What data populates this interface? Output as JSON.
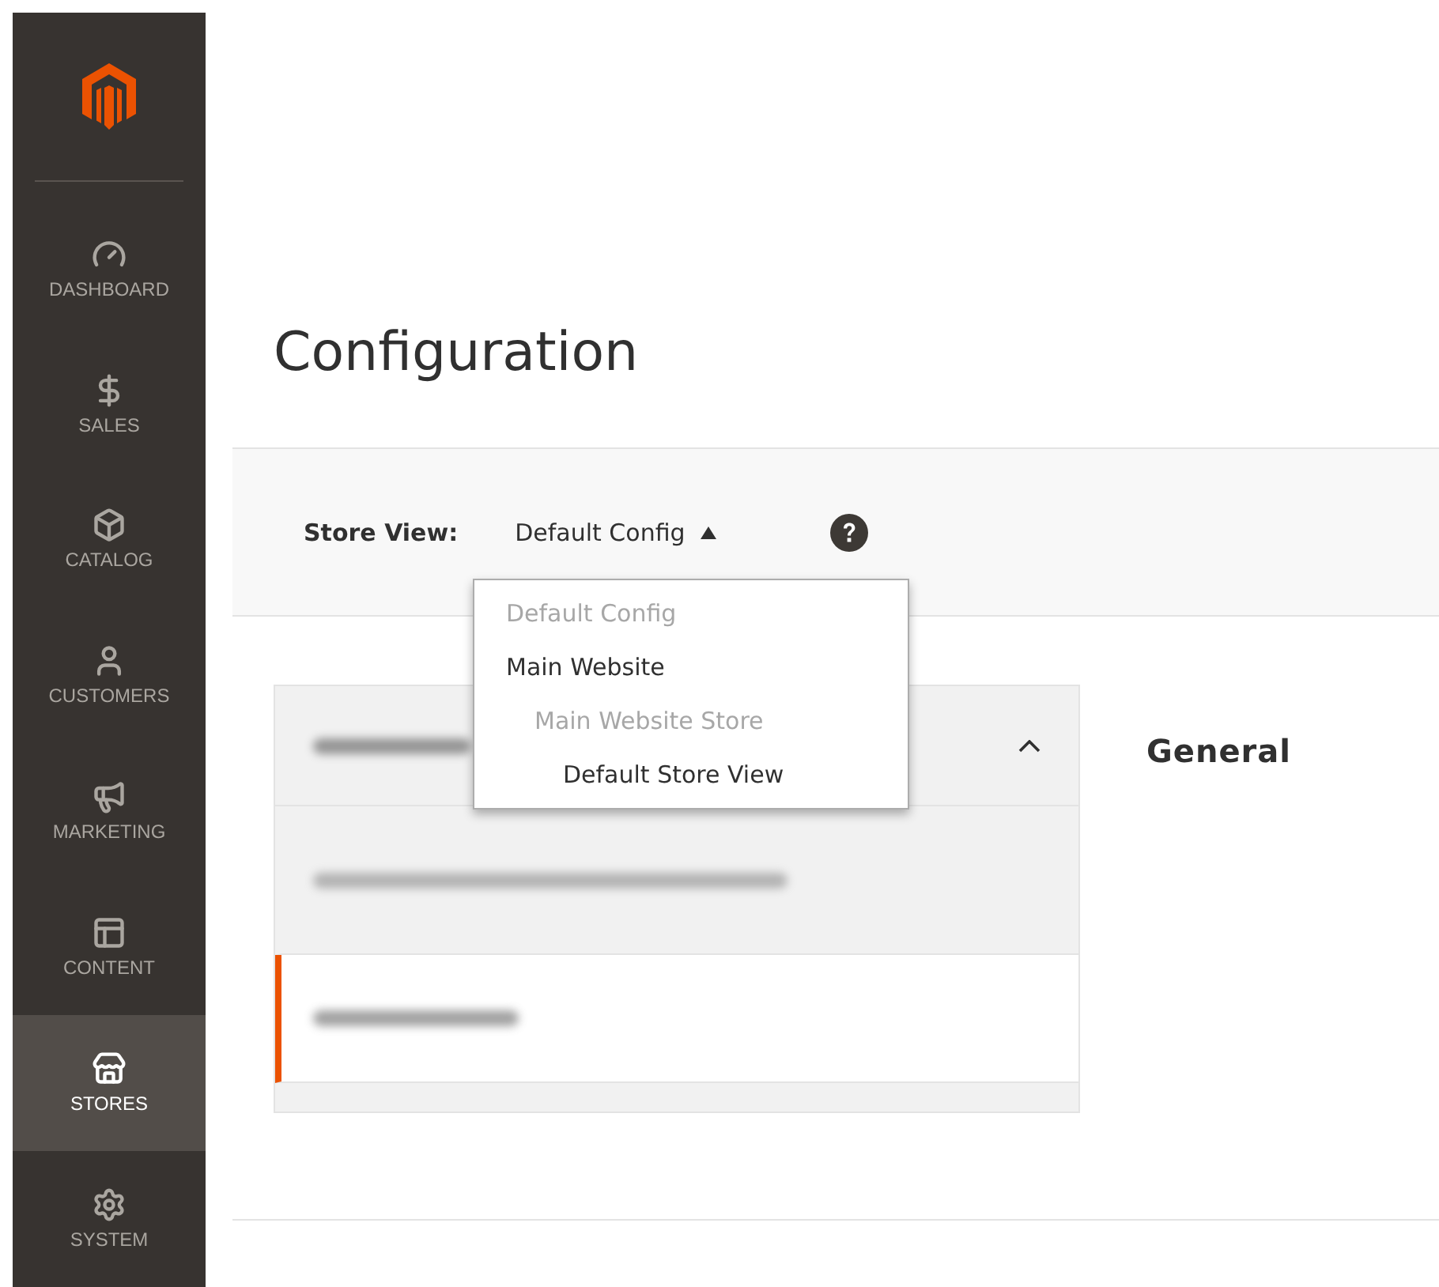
{
  "sidebar": {
    "items": [
      {
        "label": "DASHBOARD",
        "selected": false
      },
      {
        "label": "SALES",
        "selected": false
      },
      {
        "label": "CATALOG",
        "selected": false
      },
      {
        "label": "CUSTOMERS",
        "selected": false
      },
      {
        "label": "MARKETING",
        "selected": false
      },
      {
        "label": "CONTENT",
        "selected": false
      },
      {
        "label": "STORES",
        "selected": true
      },
      {
        "label": "SYSTEM",
        "selected": false
      }
    ]
  },
  "page": {
    "title": "Configuration"
  },
  "store_view": {
    "label": "Store View:",
    "value": "Default Config",
    "expanded": true,
    "options": [
      {
        "label": "Default Config",
        "disabled": true
      },
      {
        "label": "Main Website",
        "disabled": false,
        "children": [
          {
            "label": "Main Website Store",
            "disabled": true,
            "children": [
              {
                "label": "Default Store View",
                "disabled": false
              }
            ]
          }
        ]
      }
    ]
  },
  "config_nav": {
    "expanded": true,
    "items": [
      {
        "selected": false
      },
      {
        "selected": true
      }
    ]
  },
  "section": {
    "title": "General"
  }
}
